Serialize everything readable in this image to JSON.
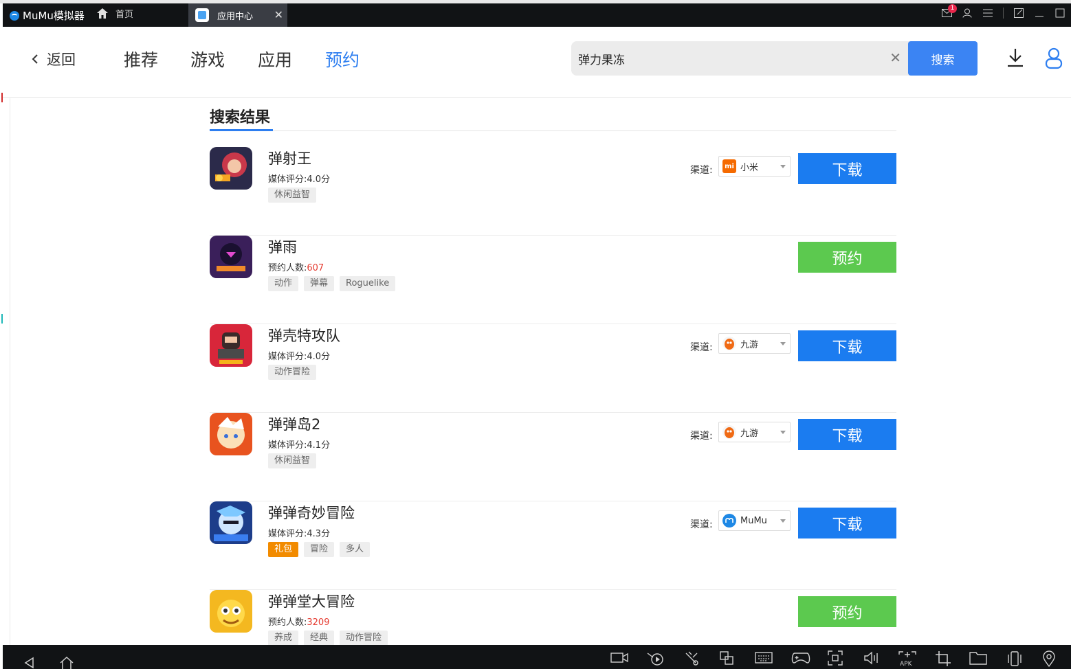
{
  "titlebar": {
    "app_name": "MuMu模拟器",
    "home_tab": "首页",
    "active_tab": "应用中心",
    "mail_badge": "1"
  },
  "header": {
    "back_label": "返回",
    "nav": [
      "推荐",
      "游戏",
      "应用",
      "预约"
    ],
    "active_nav": "预约",
    "search_value": "弹力果冻",
    "search_button": "搜索"
  },
  "section_title": "搜索结果",
  "channel_label": "渠道:",
  "results": [
    {
      "title": "弹射王",
      "meta_label": "媒体评分:",
      "meta_value": "4.0分",
      "tags": [
        "休闲益智"
      ],
      "channel": "小米",
      "channel_icon": "xiaomi-icon",
      "action": "下载"
    },
    {
      "title": "弹雨",
      "meta_label": "预约人数:",
      "meta_value": "607",
      "tags": [
        "动作",
        "弹幕",
        "Roguelike"
      ],
      "channel": "",
      "action": "预约"
    },
    {
      "title": "弹壳特攻队",
      "meta_label": "媒体评分:",
      "meta_value": "4.0分",
      "tags": [
        "动作冒险"
      ],
      "channel": "九游",
      "channel_icon": "jiuyou-icon",
      "action": "下载"
    },
    {
      "title": "弹弹岛2",
      "meta_label": "媒体评分:",
      "meta_value": "4.1分",
      "tags": [
        "休闲益智"
      ],
      "channel": "九游",
      "channel_icon": "jiuyou-icon",
      "action": "下载"
    },
    {
      "title": "弹弹奇妙冒险",
      "meta_label": "媒体评分:",
      "meta_value": "4.3分",
      "tags": [
        "礼包",
        "冒险",
        "多人"
      ],
      "channel": "MuMu",
      "channel_icon": "mumu-icon",
      "action": "下载"
    },
    {
      "title": "弹弹堂大冒险",
      "meta_label": "预约人数:",
      "meta_value": "3209",
      "tags": [
        "养成",
        "经典",
        "动作冒险"
      ],
      "channel": "",
      "action": "预约"
    }
  ],
  "colors": {
    "accent": "#2d7ef0",
    "download": "#1b7cf0",
    "reserve": "#5cc94f",
    "count": "#e53a2f",
    "gift_tag": "#f28b00"
  }
}
